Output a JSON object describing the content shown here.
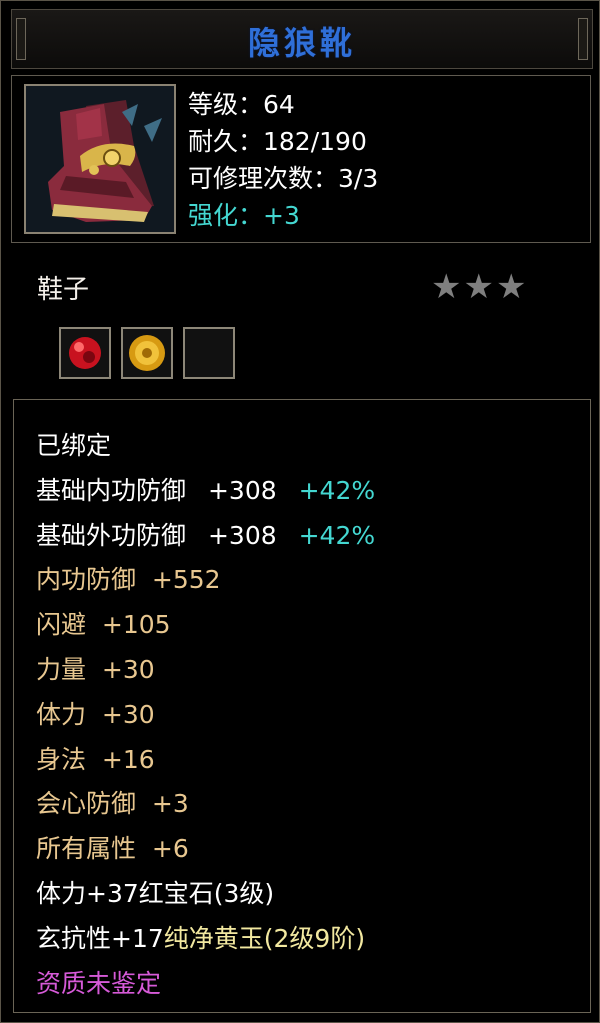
{
  "item": {
    "name": "隐狼靴",
    "stats": {
      "level": "等级：64",
      "durability": "耐久：182/190",
      "repair": "可修理次数：3/3",
      "enhance": "强化：+3"
    },
    "type": "鞋子",
    "stars": "★★★",
    "sockets": [
      "ruby-gem-icon",
      "yellow-jade-icon",
      "empty-socket"
    ],
    "bound": "已绑定",
    "base_inner_defense": {
      "label": "基础内功防御",
      "value": "+308",
      "bonus": "+42%"
    },
    "base_outer_defense": {
      "label": "基础外功防御",
      "value": "+308",
      "bonus": "+42%"
    },
    "attributes": [
      "内功防御  +552",
      "闪避  +105",
      "力量  +30",
      "体力  +30",
      "身法  +16",
      "会心防御  +3",
      "所有属性  +6"
    ],
    "gem_lines": {
      "ruby": "体力+37红宝石(3级)",
      "jade_prefix": "玄抗性+17",
      "jade_name": "纯净黄玉(2级9阶)"
    },
    "quality": "资质未鉴定"
  },
  "colors": {
    "title": "#2f6fd8",
    "enhance": "#44d7d1",
    "attribute": "#e8c790",
    "quality": "#d65ad8",
    "star": "#7f7f7f"
  }
}
